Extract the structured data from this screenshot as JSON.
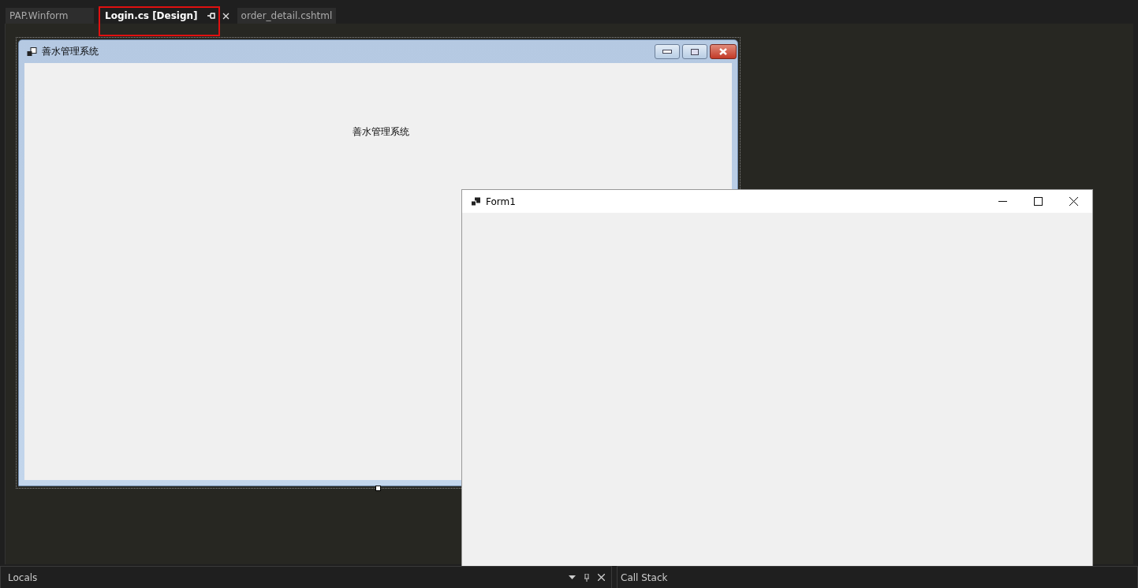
{
  "tabs": [
    {
      "label": "PAP.Winform",
      "selected": false
    },
    {
      "label": "Login.cs [Design]",
      "selected": true
    },
    {
      "label": "order_detail.cshtml",
      "selected": false
    }
  ],
  "designer": {
    "form_title": "善水管理系统",
    "label": "善水管理系统"
  },
  "running_form": {
    "title": "Form1"
  },
  "bottom_panels": [
    {
      "title": "Locals"
    },
    {
      "title": "Call Stack"
    }
  ]
}
